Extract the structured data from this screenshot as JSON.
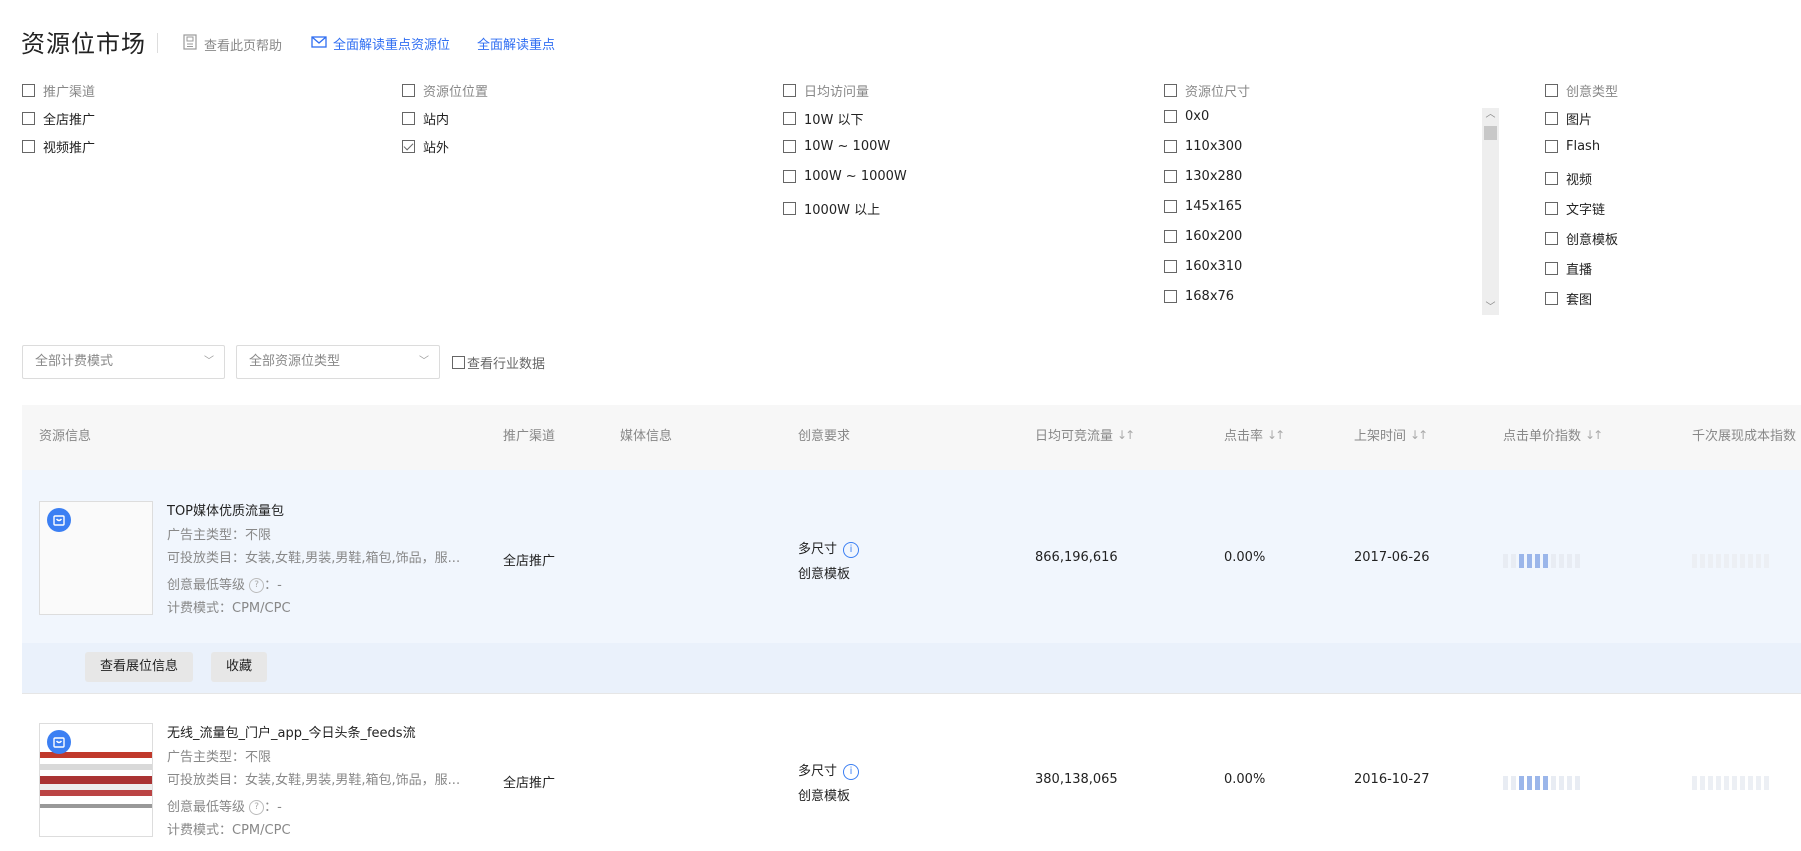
{
  "header": {
    "title": "资源位市场",
    "help_label": "查看此页帮助",
    "link1_label": "全面解读重点资源位",
    "link2_label": "全面解读重点"
  },
  "filters": {
    "channel": {
      "header": "推广渠道",
      "options": [
        {
          "label": "全店推广",
          "checked": false
        },
        {
          "label": "视频推广",
          "checked": false
        }
      ]
    },
    "position": {
      "header": "资源位位置",
      "options": [
        {
          "label": "站内",
          "checked": false
        },
        {
          "label": "站外",
          "checked": true
        }
      ]
    },
    "traffic": {
      "header": "日均访问量",
      "options": [
        {
          "label": "10W 以下"
        },
        {
          "label": "10W ~ 100W"
        },
        {
          "label": "100W ~ 1000W"
        },
        {
          "label": "1000W 以上"
        }
      ]
    },
    "size": {
      "header": "资源位尺寸",
      "options": [
        {
          "label": "0x0"
        },
        {
          "label": "110x300"
        },
        {
          "label": "130x280"
        },
        {
          "label": "145x165"
        },
        {
          "label": "160x200"
        },
        {
          "label": "160x310"
        },
        {
          "label": "168x76"
        }
      ]
    },
    "creative": {
      "header": "创意类型",
      "options": [
        {
          "label": "图片"
        },
        {
          "label": "Flash"
        },
        {
          "label": "视频"
        },
        {
          "label": "文字链"
        },
        {
          "label": "创意模板"
        },
        {
          "label": "直播"
        },
        {
          "label": "套图"
        }
      ]
    }
  },
  "toolbar": {
    "billing_select": "全部计费模式",
    "type_select": "全部资源位类型",
    "industry_label": "查看行业数据"
  },
  "table": {
    "headers": {
      "info": "资源信息",
      "channel": "推广渠道",
      "media": "媒体信息",
      "creative": "创意要求",
      "traffic": "日均可竞流量",
      "ctr": "点击率",
      "date": "上架时间",
      "cpc_index": "点击单价指数",
      "cpm_index": "千次展现成本指数"
    },
    "rows": [
      {
        "title": "TOP媒体优质流量包",
        "advertiser_label": "广告主类型：",
        "advertiser": "不限",
        "category_label": "可投放类目：",
        "category": "女装,女鞋,男装,男鞋,箱包,饰品，服...",
        "level_label": "创意最低等级",
        "level": "：-",
        "billing_label": "计费模式：",
        "billing": "CPM/CPC",
        "channel": "全店推广",
        "creative_size": "多尺寸",
        "creative_type": "创意模板",
        "traffic": "866,196,616",
        "ctr": "0.00%",
        "date": "2017-06-26",
        "cpc_level": 0.5,
        "cpm_level": 0
      },
      {
        "title": "无线_流量包_门户_app_今日头条_feeds流",
        "advertiser_label": "广告主类型：",
        "advertiser": "不限",
        "category_label": "可投放类目：",
        "category": "女装,女鞋,男装,男鞋,箱包,饰品，服...",
        "level_label": "创意最低等级",
        "level": "：-",
        "billing_label": "计费模式：",
        "billing": "CPM/CPC",
        "channel": "全店推广",
        "creative_size": "多尺寸",
        "creative_type": "创意模板",
        "traffic": "380,138,065",
        "ctr": "0.00%",
        "date": "2016-10-27",
        "cpc_level": 0.5,
        "cpm_level": 0
      }
    ],
    "actions": {
      "view_label": "查看展位信息",
      "fav_label": "收藏"
    }
  },
  "icons": {
    "help": "help-doc-icon",
    "mail": "mail-icon",
    "badge": "shopping-bag-icon"
  },
  "colors": {
    "link": "#2f6ef2",
    "badge": "#3b7ff3",
    "row_highlight": "#f1f6fd",
    "bar_on": "#9bb6ea"
  }
}
